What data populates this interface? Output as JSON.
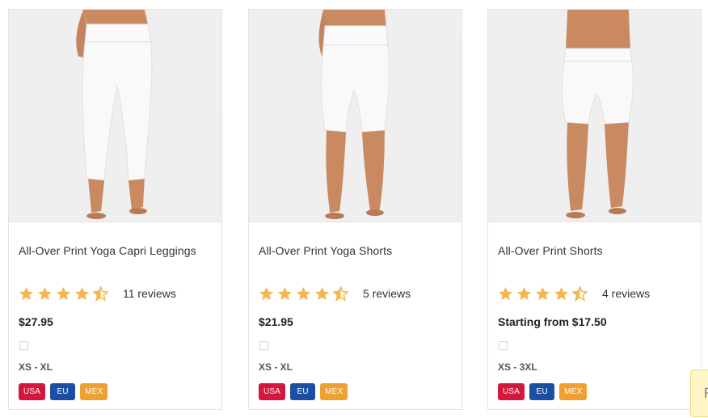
{
  "products": [
    {
      "title": "All-Over Print Yoga Capri Leggings",
      "rating": 4.5,
      "reviews": "11 reviews",
      "price": "$27.95",
      "sizes": "XS - XL",
      "image_icon": "capri-leggings-model",
      "regions": [
        "USA",
        "EU",
        "MEX"
      ]
    },
    {
      "title": "All-Over Print Yoga Shorts",
      "rating": 4.5,
      "reviews": "5 reviews",
      "price": "$21.95",
      "sizes": "XS - XL",
      "image_icon": "yoga-shorts-model",
      "regions": [
        "USA",
        "EU",
        "MEX"
      ]
    },
    {
      "title": "All-Over Print Shorts",
      "rating": 4.5,
      "reviews": "4 reviews",
      "price": "Starting from $17.50",
      "sizes": "XS - 3XL",
      "image_icon": "shorts-model",
      "regions": [
        "USA",
        "EU",
        "MEX"
      ]
    }
  ],
  "colors": {
    "star": "#f5b54f",
    "usa": "#d4173c",
    "eu": "#1b4fa3",
    "mex": "#f0a030",
    "feedback_tab": "#fff5c7"
  },
  "feedback_icon": "flag-icon"
}
